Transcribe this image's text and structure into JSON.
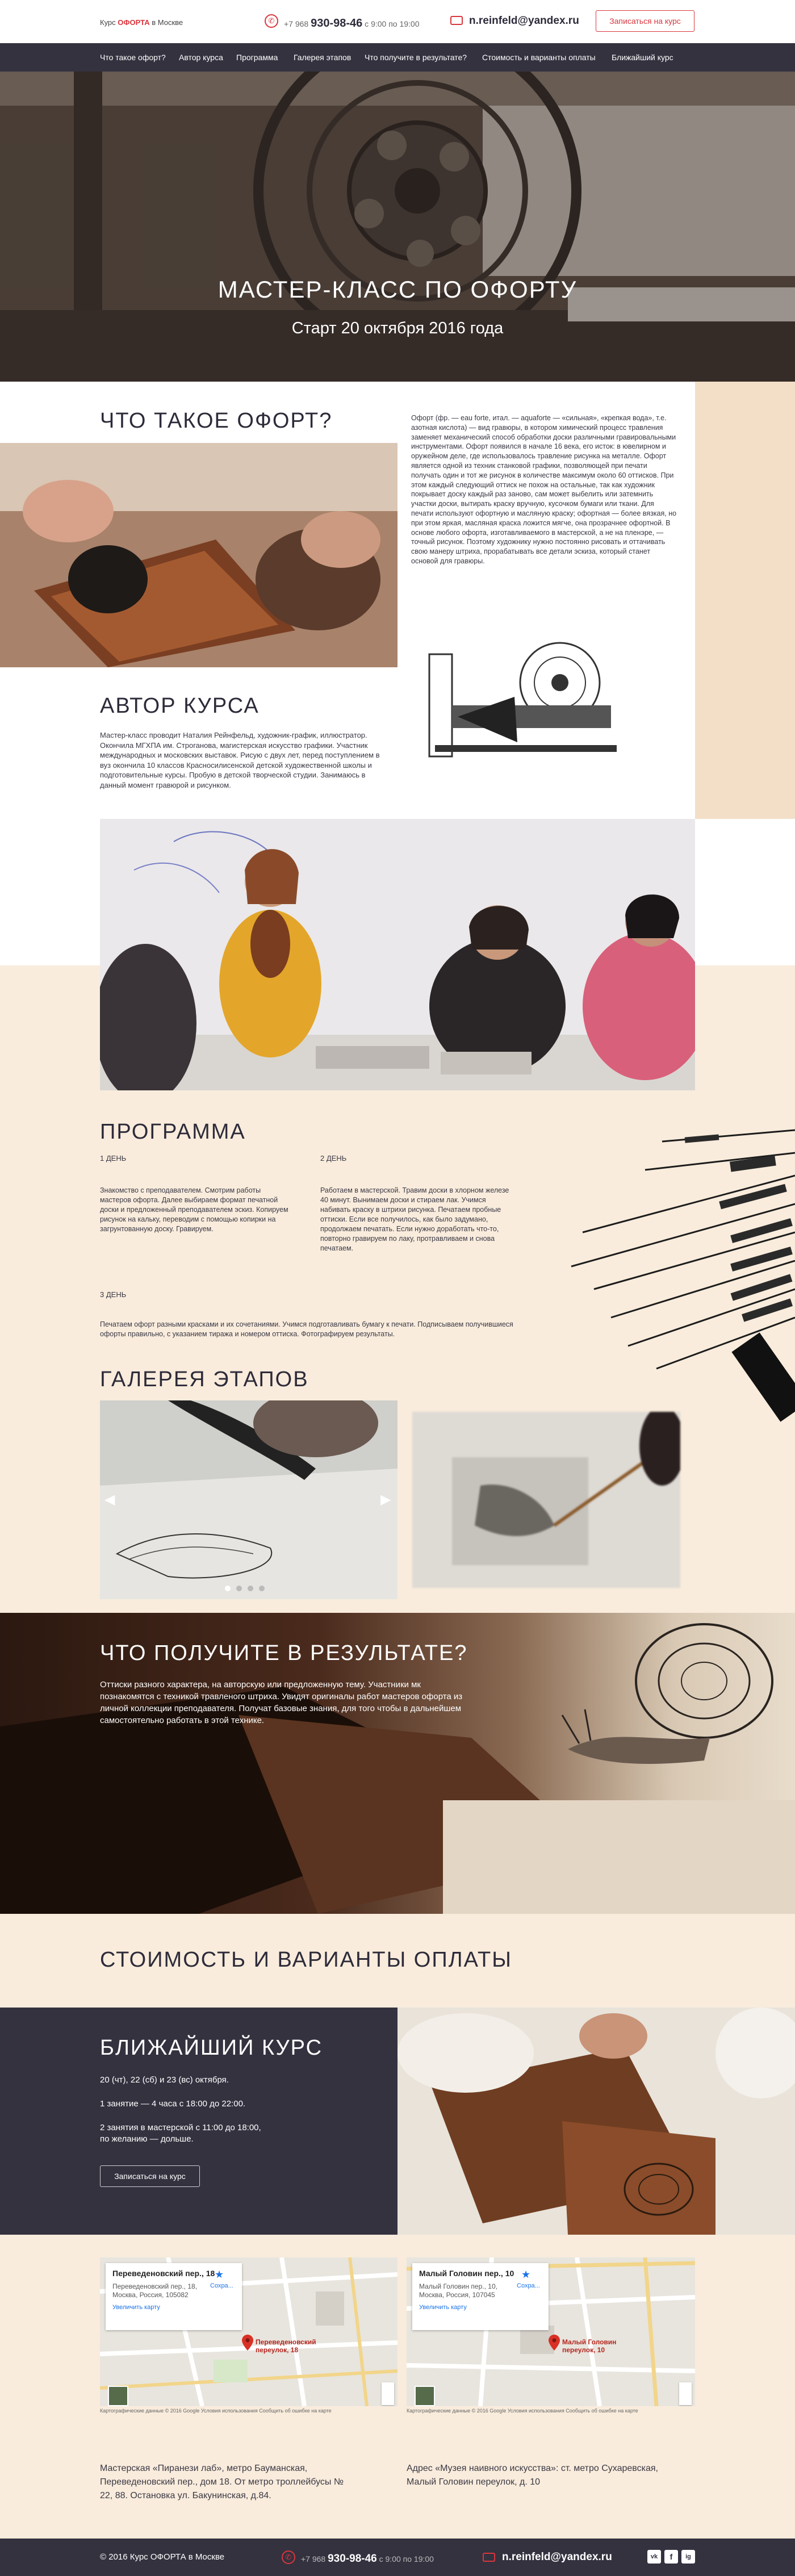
{
  "header": {
    "logo_prefix": "Курс ",
    "logo_brand": "ОФОРТА",
    "logo_suffix": " в Москве",
    "phone_prefix": "+7 968 ",
    "phone_main": "930-98-46",
    "phone_hours": " с 9:00 по 19:00",
    "email": "n.reinfeld@yandex.ru",
    "signup_button": "Записаться на курс"
  },
  "nav": {
    "items": [
      "Что такое офорт?",
      "Автор курса",
      "Программа",
      "Галерея этапов",
      "Что получите в результате?",
      "Стоимость и варианты оплаты",
      "Ближайший курс"
    ]
  },
  "hero": {
    "title": "МАСТЕР-КЛАСС ПО ОФОРТУ",
    "subtitle": "Старт 20 октября 2016 года"
  },
  "what": {
    "title": "ЧТО ТАКОЕ ОФОРТ?",
    "text": "Офорт (фр. — eau forte, итал. — aquaforte — «сильная», «крепкая вода», т.е. азотная кислота) — вид гравюры, в котором химический процесс травления заменяет механический способ обработки доски различными гравировальными инструментами. Офорт появился в начале 16 века, его исток: в ювелирном и оружейном деле, где использовалось травление рисунка на металле. Офорт является одной из техник станковой графики, позволяющей при печати получать один и тот же рисунок в количестве максимум около 60 оттисков. При этом каждый следующий оттиск не похож на остальные, так как художник покрывает доску каждый раз заново, сам может выбелить или затемнить участки доски, вытирать краску вручную, кусочком бумаги или ткани. Для печати используют офортную и масляную краску; офортная — более вязкая, но при этом яркая, масляная краска ложится мягче, она прозрачнее офортной. В основе любого офорта, изготавливаемого в мастерской, а не на пленэре, — точный рисунок. Поэтому художнику нужно постоянно рисовать и оттачивать свою манеру штриха, прорабатывать все детали эскиза, который станет основой для гравюры."
  },
  "author": {
    "title": "АВТОР КУРСА",
    "text": "Мастер-класс проводит Наталия Рейнфельд, художник-график, иллюстратор. Окончила МГХПА им. Строганова, магистерская искусство графики. Участник международных и московских выставок. Рисую с двух лет, перед поступлением в вуз окончила 10 классов Красносилисенской детской художественной школы и подготовительные курсы. Пробую в детской творческой студии. Занимаюсь в данный момент гравюрой и рисунком."
  },
  "program": {
    "title": "ПРОГРАММА",
    "days": [
      {
        "label": "1 ДЕНЬ",
        "text": "Знакомство с преподавателем. Смотрим работы мастеров офорта. Далее выбираем формат печатной доски и предложенный преподавателем эскиз. Копируем рисунок на кальку, переводим с помощью копирки на загрунтованную доску. Гравируем."
      },
      {
        "label": "2 ДЕНЬ",
        "text": "Работаем в мастерской. Травим доски в хлорном железе 40 минут. Вынимаем доски и стираем лак. Учимся набивать краску в штрихи рисунка. Печатаем пробные оттиски. Если все получилось, как было задумано, продолжаем печатать. Если нужно доработать что-то, повторно гравируем по лаку, протравливаем и снова печатаем."
      },
      {
        "label": "3 ДЕНЬ",
        "text": "Печатаем офорт разными красками и их сочетаниями. Учимся подготавливать бумагу к печати. Подписываем получившиеся офорты правильно, с указанием тиража и номером оттиска. Фотографируем результаты."
      }
    ]
  },
  "gallery": {
    "title": "ГАЛЕРЕЯ ЭТАПОВ",
    "prev": "◀",
    "next": "▶"
  },
  "result": {
    "title": "ЧТО ПОЛУЧИТЕ В РЕЗУЛЬТАТЕ?",
    "text": "Оттиски разного характера, на авторскую или предложенную тему. Участники мк познакомятся с техникой травленого штриха. Увидят оригиналы работ мастеров офорта из личной коллекции преподавателя. Получат базовые знания, для того чтобы в дальнейшем самостоятельно работать в этой технике."
  },
  "price": {
    "title": "СТОИМОСТЬ И ВАРИАНТЫ ОПЛАТЫ"
  },
  "next_course": {
    "title": "БЛИЖАЙШИЙ КУРС",
    "dates": "20 (чт), 22 (сб) и 23 (вс) октября.",
    "line1": "1 занятие — 4 часа с 18:00 до 22:00.",
    "line2": "2 занятия в мастерской с 11:00 до 18:00,",
    "line3": "по желанию — дольше.",
    "button": "Записаться на курс"
  },
  "maps": [
    {
      "card_title": "Переведеновский пер., 18",
      "card_addr": "Переведеновский пер., 18, Москва, Россия, 105082",
      "card_link": "Увеличить карту",
      "save": "Сохра...",
      "pin_label": "Переведеновский переулок, 18",
      "caption": "Мастерская «Пиранези лаб», метро Бауманская, Переведеновский пер., дом 18. От метро троллейбусы № 22, 88. Остановка ул. Бакунинская, д.84."
    },
    {
      "card_title": "Малый Головин пер., 10",
      "card_addr": "Малый Головин пер., 10, Москва, Россия, 107045",
      "card_link": "Увеличить карту",
      "save": "Сохра...",
      "pin_label": "Малый Головин переулок, 10",
      "caption": "Адрес «Музея наивного искусства»: ст. метро Сухаревская, Малый Головин переулок, д. 10"
    }
  ],
  "map_footer": "Картографические данные © 2016 Google  Условия использования  Сообщить об ошибке на карте",
  "footer": {
    "copyright": "© 2016 Курс ОФОРТА в Москве",
    "phone_prefix": "+7 968 ",
    "phone_main": "930-98-46",
    "phone_hours": " с 9:00 по 19:00",
    "email": "n.reinfeld@yandex.ru",
    "social": [
      "vk",
      "f",
      "ig"
    ]
  },
  "colors": {
    "accent": "#d9363e",
    "dark": "#34323f",
    "beige": "#f3dfc8"
  }
}
